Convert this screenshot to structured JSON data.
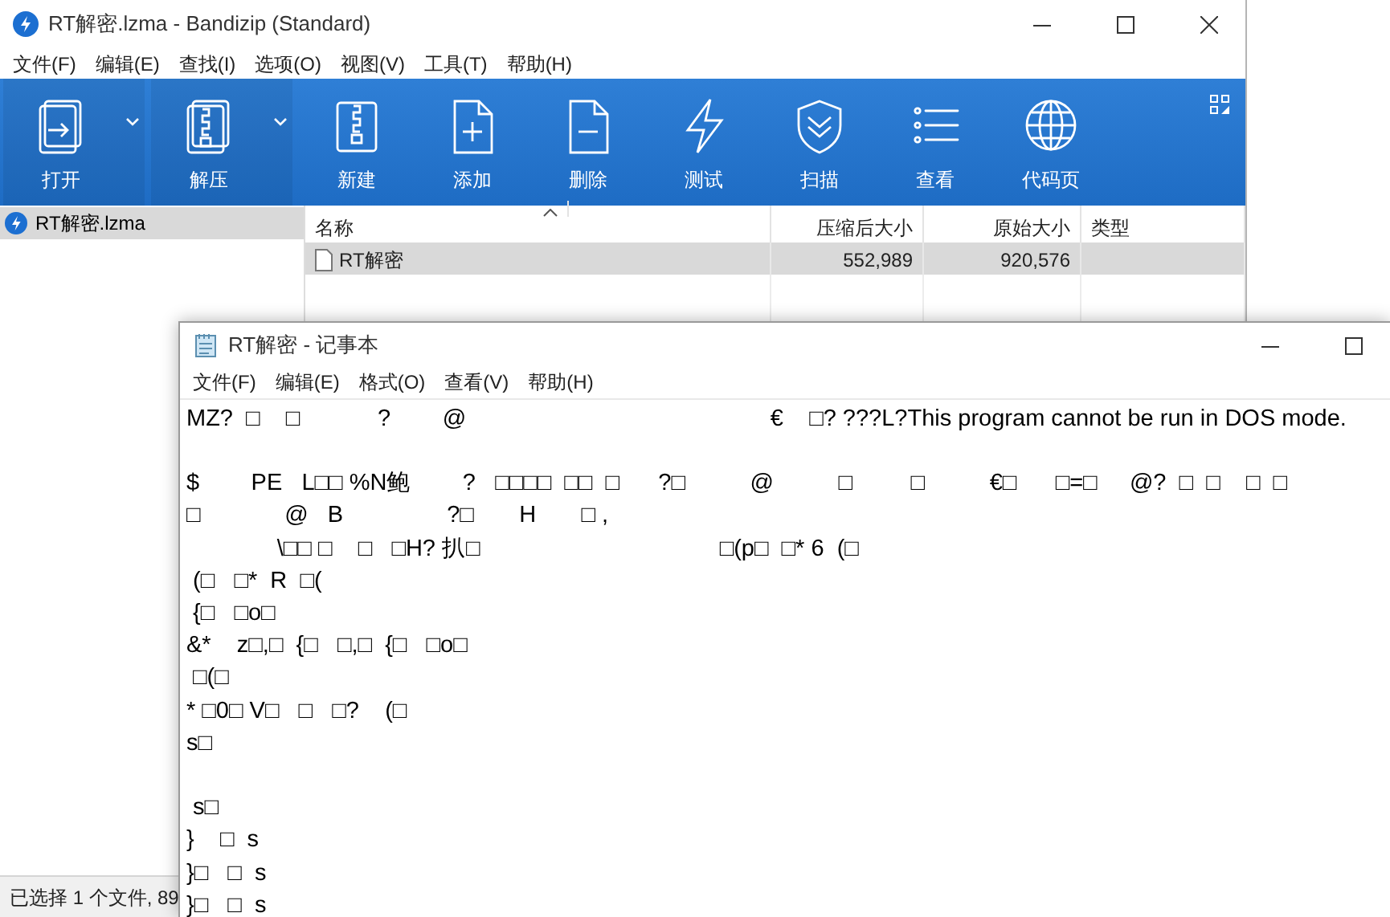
{
  "archiver": {
    "title": "RT解密.lzma - Bandizip (Standard)",
    "menu": [
      "文件(F)",
      "编辑(E)",
      "查找(I)",
      "选项(O)",
      "视图(V)",
      "工具(T)",
      "帮助(H)"
    ],
    "toolbar": [
      {
        "label": "打开",
        "dropdown": true
      },
      {
        "label": "解压",
        "dropdown": true
      },
      {
        "label": "新建",
        "dropdown": false
      },
      {
        "label": "添加",
        "dropdown": false
      },
      {
        "label": "删除",
        "dropdown": false
      },
      {
        "label": "测试",
        "dropdown": false
      },
      {
        "label": "扫描",
        "dropdown": false
      },
      {
        "label": "查看",
        "dropdown": false
      },
      {
        "label": "代码页",
        "dropdown": false
      }
    ],
    "tree": [
      {
        "label": "RT解密.lzma",
        "selected": true
      }
    ],
    "columns": [
      "名称",
      "压缩后大小",
      "原始大小",
      "类型"
    ],
    "rows": [
      {
        "name": "RT解密",
        "compressed": "552,989",
        "original": "920,576",
        "selected": true
      }
    ],
    "status": "已选择 1 个文件, 89"
  },
  "notepad": {
    "title": "RT解密 - 记事本",
    "menu": [
      "文件(F)",
      "编辑(E)",
      "格式(O)",
      "查看(V)",
      "帮助(H)"
    ],
    "text": "MZ?  □    □            ?        @                                               €    □? ???L?This program cannot be run in DOS mode.\n\n$        PE   L□□ %N鲍        ?   □□□□  □□  □      ?□          @          □         □          €□      □=□     @?  □  □    □  □\n□             @   B                ?□       H       □ ,\n              \\□□ □    □   □H? 扒□                                     □(p□  □* 6  (□\n (□   □*  R  □(\n {□   □o□\n&*    z□,□  {□   □,□  {□   □o□\n □(□\n* □0□ V□   □   □?    (□\ns□\n\n s□\n}    □  s\n}□   □  s\n}□   □  s"
  }
}
